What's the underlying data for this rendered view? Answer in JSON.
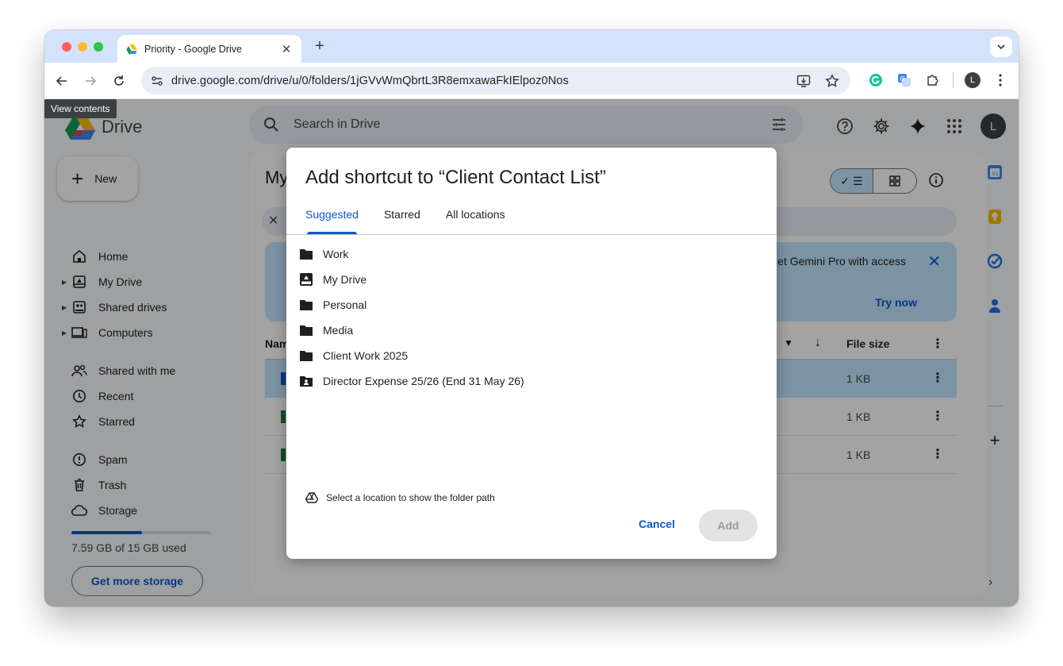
{
  "browser": {
    "tab_title": "Priority - Google Drive",
    "url": "drive.google.com/drive/u/0/folders/1jGVvWmQbrtL3R8emxawaFkIElpoz0Nos",
    "profile_initial": "L"
  },
  "tooltip": "View contents",
  "drive": {
    "logo_text": "Drive",
    "search_placeholder": "Search in Drive",
    "account_initial": "L",
    "new_label": "New",
    "nav": [
      {
        "label": "Home",
        "icon": "home-icon"
      },
      {
        "label": "My Drive",
        "icon": "my-drive-icon"
      },
      {
        "label": "Shared drives",
        "icon": "shared-drives-icon"
      },
      {
        "label": "Computers",
        "icon": "computers-icon"
      },
      {
        "label": "Shared with me",
        "icon": "people-icon"
      },
      {
        "label": "Recent",
        "icon": "clock-icon"
      },
      {
        "label": "Starred",
        "icon": "star-icon"
      },
      {
        "label": "Spam",
        "icon": "spam-icon"
      },
      {
        "label": "Trash",
        "icon": "trash-icon"
      },
      {
        "label": "Storage",
        "icon": "cloud-icon"
      }
    ],
    "storage": {
      "used_text": "7.59 GB of 15 GB used",
      "used_fraction": 0.506,
      "cta": "Get more storage"
    },
    "main_title_partial": "My",
    "banner": {
      "text": "et Gemini Pro with access",
      "cta": "Try now"
    },
    "list_header": {
      "name_partial": "Nam",
      "size": "File size"
    },
    "files": [
      {
        "size": "1 KB",
        "selected": true,
        "icon_color": "#0b57d0"
      },
      {
        "size": "1 KB",
        "selected": false,
        "icon_color": "#188038"
      },
      {
        "size": "1 KB",
        "selected": false,
        "icon_color": "#188038"
      }
    ]
  },
  "dialog": {
    "title": "Add shortcut to “Client Contact List”",
    "tabs": [
      "Suggested",
      "Starred",
      "All locations"
    ],
    "active_tab": "Suggested",
    "locations": [
      {
        "label": "Work",
        "icon": "folder-icon"
      },
      {
        "label": "My Drive",
        "icon": "my-drive-icon"
      },
      {
        "label": "Personal",
        "icon": "folder-icon"
      },
      {
        "label": "Media",
        "icon": "folder-icon"
      },
      {
        "label": "Client Work 2025",
        "icon": "folder-icon"
      },
      {
        "label": "Director Expense 25/26 (End 31 May 26)",
        "icon": "shared-folder-icon"
      }
    ],
    "hint": "Select a location to show the folder path",
    "cancel_label": "Cancel",
    "add_label": "Add"
  },
  "colors": {
    "accent": "#0b57d0",
    "selected_row": "#c2e7ff",
    "tabstrip": "#d3e3fd"
  }
}
